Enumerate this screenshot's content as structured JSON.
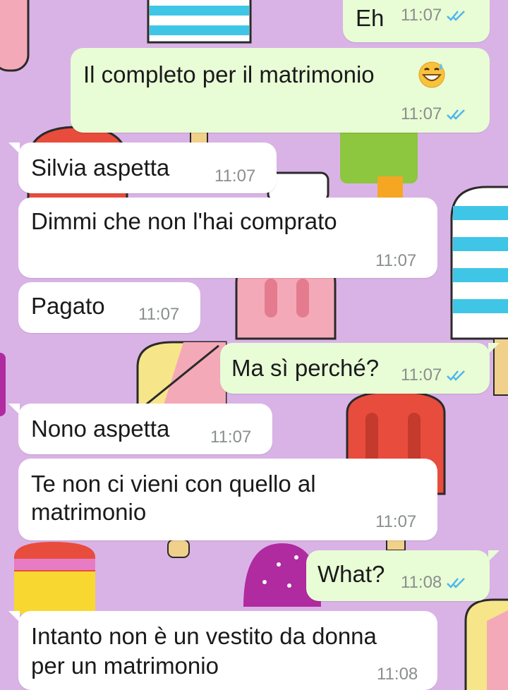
{
  "colors": {
    "background": "#d9b3e6",
    "incoming_bubble": "#ffffff",
    "outgoing_bubble": "#e8fcd6",
    "read_ticks": "#4fb6ec",
    "timestamp": "#8a8f8c"
  },
  "messages": [
    {
      "direction": "out",
      "text": "Eh",
      "time": "11:07",
      "status": "read"
    },
    {
      "direction": "out",
      "text": "Il completo per il matrimonio",
      "emoji": "grinning-face-with-sweat",
      "time": "11:07",
      "status": "read"
    },
    {
      "direction": "in",
      "text": "Silvia aspetta",
      "time": "11:07"
    },
    {
      "direction": "in",
      "text": "Dimmi che non l'hai comprato",
      "time": "11:07"
    },
    {
      "direction": "in",
      "text": "Pagato",
      "time": "11:07"
    },
    {
      "direction": "out",
      "text": "Ma sì perché?",
      "time": "11:07",
      "status": "read"
    },
    {
      "direction": "in",
      "text": "Nono aspetta",
      "time": "11:07"
    },
    {
      "direction": "in",
      "lines": [
        "Te non ci vieni con quello al",
        "matrimonio"
      ],
      "time": "11:07"
    },
    {
      "direction": "out",
      "text": "What?",
      "time": "11:08",
      "status": "read"
    },
    {
      "direction": "in",
      "lines": [
        "Intanto non è un vestito da donna",
        "per un matrimonio"
      ],
      "time": "11:08"
    }
  ]
}
